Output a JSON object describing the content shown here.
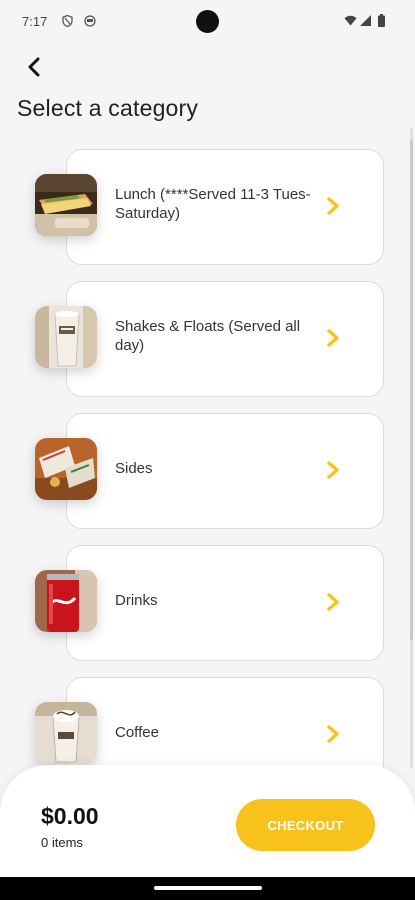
{
  "status_bar": {
    "time": "7:17",
    "icons": [
      "shield-icon",
      "face-icon",
      "wifi-icon",
      "signal-icon",
      "battery-icon"
    ]
  },
  "header": {
    "back_icon": "chevron-left-icon",
    "title": "Select a category"
  },
  "categories": [
    {
      "label": "Lunch (****Served 11-3 Tues-Saturday)",
      "image": "lunch-image"
    },
    {
      "label": "Shakes & Floats (Served all day)",
      "image": "shake-image"
    },
    {
      "label": "Sides",
      "image": "sides-image"
    },
    {
      "label": "Drinks",
      "image": "drinks-image"
    },
    {
      "label": "Coffee",
      "image": "coffee-image"
    }
  ],
  "cart": {
    "total": "$0.00",
    "item_count": "0 items",
    "checkout_label": "CHECKOUT"
  },
  "colors": {
    "accent": "#f8c21d",
    "background": "#f5f5f5",
    "card": "#ffffff"
  }
}
